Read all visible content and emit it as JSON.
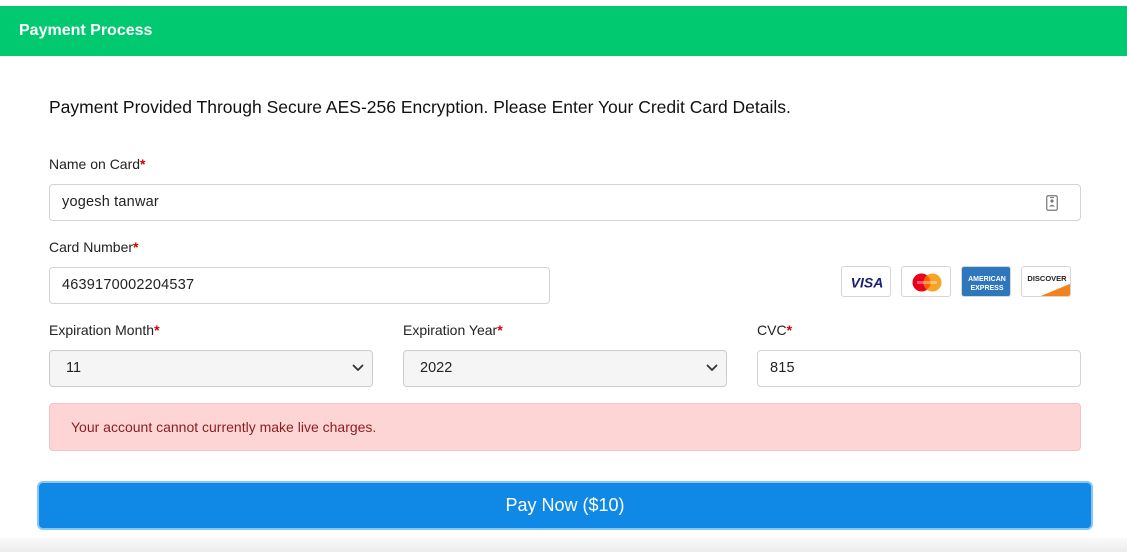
{
  "header": {
    "title": "Payment Process"
  },
  "intro": "Payment Provided Through Secure AES-256 Encryption. Please Enter Your Credit Card Details.",
  "form": {
    "required_mark": "*",
    "name": {
      "label": "Name on Card",
      "value": "yogesh tanwar"
    },
    "card_number": {
      "label": "Card Number",
      "value": "4639170002204537"
    },
    "exp_month": {
      "label": "Expiration Month",
      "value": "11"
    },
    "exp_year": {
      "label": "Expiration Year",
      "value": "2022"
    },
    "cvc": {
      "label": "CVC",
      "value": "815"
    }
  },
  "card_logos": {
    "visa": "VISA",
    "amex_line1": "AMERICAN",
    "amex_line2": "EXPRESS",
    "discover": "DISCOVER"
  },
  "alert": {
    "message": "Your account cannot currently make live charges."
  },
  "pay_button": {
    "label": "Pay Now ($10)"
  },
  "colors": {
    "header": "#01c96f",
    "button": "#1089e6",
    "alert_bg": "#fed5d5",
    "alert_text": "#8b1d1d",
    "required": "#d40000"
  }
}
